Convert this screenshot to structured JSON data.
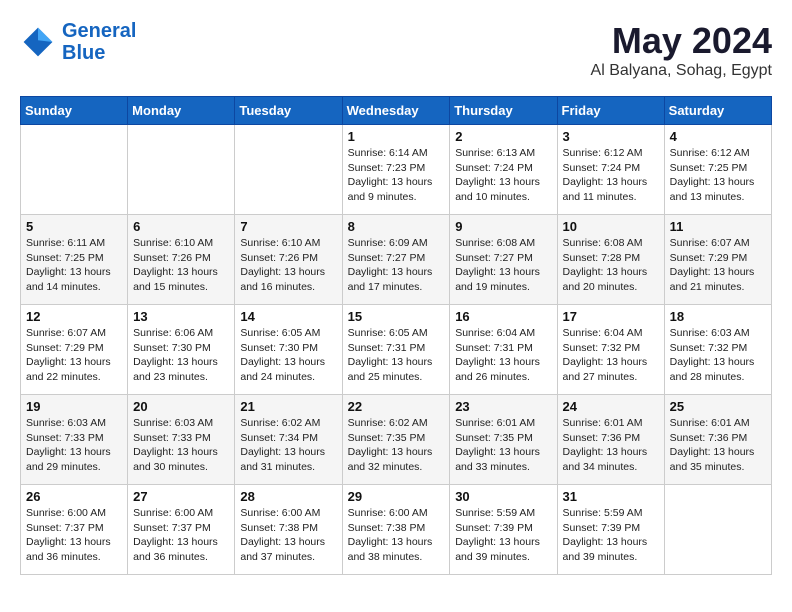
{
  "header": {
    "logo_line1": "General",
    "logo_line2": "Blue",
    "title": "May 2024",
    "subtitle": "Al Balyana, Sohag, Egypt"
  },
  "weekdays": [
    "Sunday",
    "Monday",
    "Tuesday",
    "Wednesday",
    "Thursday",
    "Friday",
    "Saturday"
  ],
  "weeks": [
    [
      {
        "day": "",
        "detail": ""
      },
      {
        "day": "",
        "detail": ""
      },
      {
        "day": "",
        "detail": ""
      },
      {
        "day": "1",
        "detail": "Sunrise: 6:14 AM\nSunset: 7:23 PM\nDaylight: 13 hours\nand 9 minutes."
      },
      {
        "day": "2",
        "detail": "Sunrise: 6:13 AM\nSunset: 7:24 PM\nDaylight: 13 hours\nand 10 minutes."
      },
      {
        "day": "3",
        "detail": "Sunrise: 6:12 AM\nSunset: 7:24 PM\nDaylight: 13 hours\nand 11 minutes."
      },
      {
        "day": "4",
        "detail": "Sunrise: 6:12 AM\nSunset: 7:25 PM\nDaylight: 13 hours\nand 13 minutes."
      }
    ],
    [
      {
        "day": "5",
        "detail": "Sunrise: 6:11 AM\nSunset: 7:25 PM\nDaylight: 13 hours\nand 14 minutes."
      },
      {
        "day": "6",
        "detail": "Sunrise: 6:10 AM\nSunset: 7:26 PM\nDaylight: 13 hours\nand 15 minutes."
      },
      {
        "day": "7",
        "detail": "Sunrise: 6:10 AM\nSunset: 7:26 PM\nDaylight: 13 hours\nand 16 minutes."
      },
      {
        "day": "8",
        "detail": "Sunrise: 6:09 AM\nSunset: 7:27 PM\nDaylight: 13 hours\nand 17 minutes."
      },
      {
        "day": "9",
        "detail": "Sunrise: 6:08 AM\nSunset: 7:27 PM\nDaylight: 13 hours\nand 19 minutes."
      },
      {
        "day": "10",
        "detail": "Sunrise: 6:08 AM\nSunset: 7:28 PM\nDaylight: 13 hours\nand 20 minutes."
      },
      {
        "day": "11",
        "detail": "Sunrise: 6:07 AM\nSunset: 7:29 PM\nDaylight: 13 hours\nand 21 minutes."
      }
    ],
    [
      {
        "day": "12",
        "detail": "Sunrise: 6:07 AM\nSunset: 7:29 PM\nDaylight: 13 hours\nand 22 minutes."
      },
      {
        "day": "13",
        "detail": "Sunrise: 6:06 AM\nSunset: 7:30 PM\nDaylight: 13 hours\nand 23 minutes."
      },
      {
        "day": "14",
        "detail": "Sunrise: 6:05 AM\nSunset: 7:30 PM\nDaylight: 13 hours\nand 24 minutes."
      },
      {
        "day": "15",
        "detail": "Sunrise: 6:05 AM\nSunset: 7:31 PM\nDaylight: 13 hours\nand 25 minutes."
      },
      {
        "day": "16",
        "detail": "Sunrise: 6:04 AM\nSunset: 7:31 PM\nDaylight: 13 hours\nand 26 minutes."
      },
      {
        "day": "17",
        "detail": "Sunrise: 6:04 AM\nSunset: 7:32 PM\nDaylight: 13 hours\nand 27 minutes."
      },
      {
        "day": "18",
        "detail": "Sunrise: 6:03 AM\nSunset: 7:32 PM\nDaylight: 13 hours\nand 28 minutes."
      }
    ],
    [
      {
        "day": "19",
        "detail": "Sunrise: 6:03 AM\nSunset: 7:33 PM\nDaylight: 13 hours\nand 29 minutes."
      },
      {
        "day": "20",
        "detail": "Sunrise: 6:03 AM\nSunset: 7:33 PM\nDaylight: 13 hours\nand 30 minutes."
      },
      {
        "day": "21",
        "detail": "Sunrise: 6:02 AM\nSunset: 7:34 PM\nDaylight: 13 hours\nand 31 minutes."
      },
      {
        "day": "22",
        "detail": "Sunrise: 6:02 AM\nSunset: 7:35 PM\nDaylight: 13 hours\nand 32 minutes."
      },
      {
        "day": "23",
        "detail": "Sunrise: 6:01 AM\nSunset: 7:35 PM\nDaylight: 13 hours\nand 33 minutes."
      },
      {
        "day": "24",
        "detail": "Sunrise: 6:01 AM\nSunset: 7:36 PM\nDaylight: 13 hours\nand 34 minutes."
      },
      {
        "day": "25",
        "detail": "Sunrise: 6:01 AM\nSunset: 7:36 PM\nDaylight: 13 hours\nand 35 minutes."
      }
    ],
    [
      {
        "day": "26",
        "detail": "Sunrise: 6:00 AM\nSunset: 7:37 PM\nDaylight: 13 hours\nand 36 minutes."
      },
      {
        "day": "27",
        "detail": "Sunrise: 6:00 AM\nSunset: 7:37 PM\nDaylight: 13 hours\nand 36 minutes."
      },
      {
        "day": "28",
        "detail": "Sunrise: 6:00 AM\nSunset: 7:38 PM\nDaylight: 13 hours\nand 37 minutes."
      },
      {
        "day": "29",
        "detail": "Sunrise: 6:00 AM\nSunset: 7:38 PM\nDaylight: 13 hours\nand 38 minutes."
      },
      {
        "day": "30",
        "detail": "Sunrise: 5:59 AM\nSunset: 7:39 PM\nDaylight: 13 hours\nand 39 minutes."
      },
      {
        "day": "31",
        "detail": "Sunrise: 5:59 AM\nSunset: 7:39 PM\nDaylight: 13 hours\nand 39 minutes."
      },
      {
        "day": "",
        "detail": ""
      }
    ]
  ]
}
